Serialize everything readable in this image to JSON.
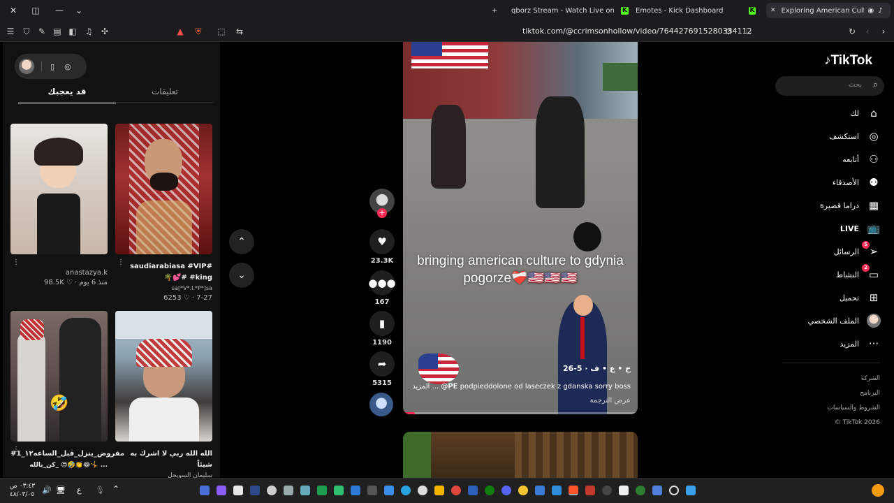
{
  "browser": {
    "tabs": [
      {
        "label": "qborz Stream - Watch Live on Kick"
      },
      {
        "label": "Emotes - Kick Dashboard"
      },
      {
        "label": "Exploring American Culture in"
      }
    ],
    "new_tab_label": "+",
    "url": "tiktok.com/@ccrimsonhollow/video/7644276915280334112"
  },
  "left_panel": {
    "tabs": {
      "comments": "تعليقات",
      "you_may_like": "قد يعجبك"
    },
    "cards": [
      {
        "title": "",
        "user": "anastazya.k",
        "likes": "98.5K",
        "age": "منذ 6 يوم"
      },
      {
        "title": "saudiarabiasa #VIP#",
        "title2": "🌴💕# #king",
        "user": "sa[*V*.I.*P*]sa",
        "likes": "6253",
        "age": "7-27"
      },
      {
        "title": "#مفروض_ينزل_قبل_الساعه١٢_1",
        "title2": "كن_بالله_ 😍🤣👏😂🤸 ...",
        "user": "",
        "likes": "",
        "age": ""
      },
      {
        "title": "الله الله ربي لا اشرك به شيئاً",
        "title2": "سليمان السويحل",
        "user": "",
        "likes": "",
        "age": ""
      }
    ]
  },
  "video": {
    "caption": "bringing american culture to gdynia pogorze❤️‍🩹🇺🇸🇺🇸🇺🇸",
    "user_line": "ح • ع • ف · 5-26",
    "description": "المزيد ...  @𝗣𝗘 podpieddolone od laseczek z gdanska sorry boss",
    "translate": "عرض الترجمة",
    "progress_percent": 5
  },
  "actions": {
    "likes": "23.3K",
    "comments": "167",
    "saves": "1190",
    "shares": "5315"
  },
  "sidebar": {
    "logo": "TikTok",
    "search_placeholder": "بحث",
    "items": [
      {
        "label": "لك",
        "icon": "home-icon"
      },
      {
        "label": "استكشف",
        "icon": "compass-icon"
      },
      {
        "label": "أتابعه",
        "icon": "user-follow-icon"
      },
      {
        "label": "الأصدقاء",
        "icon": "friends-icon"
      },
      {
        "label": "دراما قصيرة",
        "icon": "film-icon"
      },
      {
        "label": "LIVE",
        "icon": "live-icon"
      },
      {
        "label": "الرسائل",
        "icon": "send-icon",
        "badge": "5"
      },
      {
        "label": "النشاط",
        "icon": "activity-icon",
        "badge": "2"
      },
      {
        "label": "تحميل",
        "icon": "upload-icon"
      },
      {
        "label": "الملف الشخصي",
        "icon": "profile-avatar"
      },
      {
        "label": "المزيد",
        "icon": "more-icon"
      }
    ],
    "footer": [
      "الشركة",
      "البرنامج",
      "الشروط والسياسات",
      "© TikTok 2026"
    ]
  },
  "taskbar": {
    "time": "٠٣:٤٣ ص",
    "date": "٤٨/٠٣/٠٥",
    "lang": "ع"
  },
  "colors": {
    "accent": "#fe2c55",
    "kick": "#53fc18"
  }
}
